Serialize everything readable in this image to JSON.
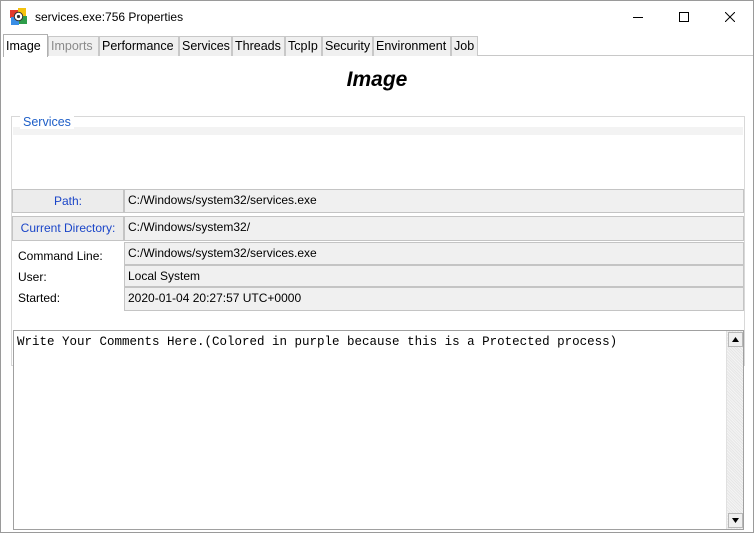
{
  "window": {
    "title": "services.exe:756 Properties",
    "icon": "process-explorer-icon"
  },
  "window_controls": {
    "minimize_icon": "minimize-icon",
    "maximize_icon": "maximize-icon",
    "close_icon": "close-icon"
  },
  "tabs": [
    {
      "label": "Image",
      "state": "active"
    },
    {
      "label": "Imports",
      "state": "disabled"
    },
    {
      "label": "Performance",
      "state": "normal"
    },
    {
      "label": "Services",
      "state": "normal"
    },
    {
      "label": "Threads",
      "state": "normal"
    },
    {
      "label": "TcpIp",
      "state": "normal"
    },
    {
      "label": "Security",
      "state": "normal"
    },
    {
      "label": "Environment",
      "state": "normal"
    },
    {
      "label": "Job",
      "state": "normal"
    }
  ],
  "page": {
    "heading": "Image"
  },
  "services": {
    "legend": "Services"
  },
  "details": {
    "path_label": "Path:",
    "path_value": "C:/Windows/system32/services.exe",
    "current_directory_label": "Current Directory:",
    "current_directory_value": "C:/Windows/system32/",
    "command_line_label": "Command Line:",
    "command_line_value": "C:/Windows/system32/services.exe",
    "user_label": "User:",
    "user_value": "Local System",
    "started_label": "Started:",
    "started_value": "2020-01-04 20:27:57 UTC+0000"
  },
  "comments": {
    "text": "Write Your Comments Here.(Colored in purple because this is a Protected process)"
  },
  "colors": {
    "link_label": "#1a45c8",
    "legend": "#2060c8",
    "field_bg": "#f0f0f0"
  }
}
